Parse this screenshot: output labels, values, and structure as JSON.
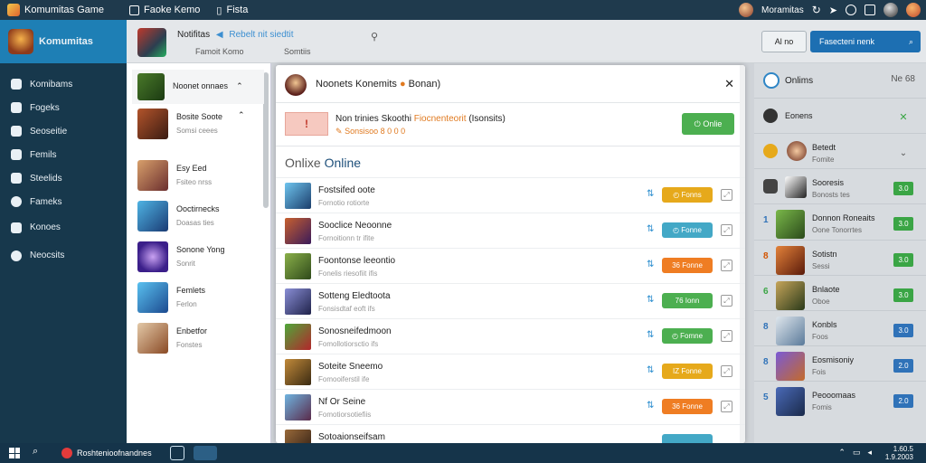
{
  "titlebar": {
    "app_title": "Komumitas Game",
    "menu1": "Faoke Kemo",
    "menu2": "Fista",
    "user_name": "Moramitas"
  },
  "sidebar": {
    "brand": "Komumitas",
    "items": [
      {
        "label": "Komibams",
        "icon": "book-icon"
      },
      {
        "label": "Fogeks",
        "icon": "card-icon"
      },
      {
        "label": "Seoseitie",
        "icon": "briefcase-icon"
      },
      {
        "label": "Femils",
        "icon": "chat-icon"
      },
      {
        "label": "Steelids",
        "icon": "list-icon"
      },
      {
        "label": "Fameks",
        "icon": "heart-icon"
      },
      {
        "label": "Konoes",
        "icon": "people-icon"
      },
      {
        "label": "Neocsits",
        "icon": "toggle-icon"
      }
    ]
  },
  "header": {
    "title": "Notifitas",
    "link": "Rebelt nit siedtit",
    "sub1": "Famoit Komo",
    "sub2": "Somtiis",
    "btn_secondary": "Al no",
    "btn_primary": "Fasecteni nenk"
  },
  "games": [
    {
      "name": "Noonet onnaes",
      "desc": ""
    },
    {
      "name": "Bosite Soote",
      "desc": "Somsi ceees"
    },
    {
      "name": "Esy Eed",
      "desc": "Fsiteo nrss"
    },
    {
      "name": "Ooctirnecks",
      "desc": "Doasas ties"
    },
    {
      "name": "Sonone Yong",
      "desc": "Sonrit"
    },
    {
      "name": "Femlets",
      "desc": "Ferlon"
    },
    {
      "name": "Enbetfor",
      "desc": "Fonstes"
    }
  ],
  "modal": {
    "title": "Noonets Konemits",
    "title_extra": "Bonan)",
    "banner_text": "Non trinies Skoothi",
    "banner_highlight": "Fiocnenteorit",
    "banner_paren": "(Isonsits)",
    "banner_sub": "Sonsisoo 8 0 0 0",
    "banner_button": "Onlie",
    "section_label": "Onlixe",
    "section_bold": "Online",
    "rows": [
      {
        "name": "Fostsifed oote",
        "sub": "Fornotio rotiorte",
        "badge": "Fonns",
        "badge_color": "#e6a91b",
        "badge_icon": "clock-icon"
      },
      {
        "name": "Sooclice Neoonne",
        "sub": "Fornoitionn tr ifite",
        "badge": "Fonne",
        "badge_color": "#43a8c6",
        "badge_icon": "clock-icon"
      },
      {
        "name": "Foontonse leeontio",
        "sub": "Fonelis riesofiit ifis",
        "badge": "36 Fonne",
        "badge_color": "#ef7d23",
        "badge_icon": ""
      },
      {
        "name": "Sotteng Eledtoota",
        "sub": "Fonsisdtaf eoft ifs",
        "badge": "76 Ionn",
        "badge_color": "#4caf50",
        "badge_icon": ""
      },
      {
        "name": "Sonosneifedmoon",
        "sub": "Fomollotiorsctio ifs",
        "badge": "Fomne",
        "badge_color": "#4caf50",
        "badge_icon": "clock-icon"
      },
      {
        "name": "Soteite Sneemo",
        "sub": "Fomooiferstil ife",
        "badge": "IZ Fonne",
        "badge_color": "#e6a91b",
        "badge_icon": ""
      },
      {
        "name": "Nf Or Seine",
        "sub": "Fomotiorsotiefiis",
        "badge": "36 Fonne",
        "badge_color": "#ef7d23",
        "badge_icon": ""
      },
      {
        "name": "Sotoaionseifsam",
        "sub": "",
        "badge": "",
        "badge_color": "#43a8c6",
        "badge_icon": ""
      }
    ]
  },
  "right_panel": {
    "header": "Onlims",
    "header_right": "Ne 68",
    "rows": [
      {
        "name": "Eonens",
        "sub": "",
        "badge": "✕",
        "badge_color": "#3aa545"
      },
      {
        "name": "Betedt",
        "sub": "Fomite",
        "badge": "✓",
        "badge_color": "#555555"
      },
      {
        "name": "Sooresis",
        "sub": "Bonosts tes",
        "badge": "3.0",
        "badge_color": "#3aa545"
      },
      {
        "name": "Donnon Roneaits",
        "sub": "Oone\nTonorrtes",
        "badge": "3.0",
        "badge_color": "#3aa545",
        "num": "1"
      },
      {
        "name": "Sotistn",
        "sub": "Sessi",
        "badge": "3.0",
        "badge_color": "#3aa545",
        "num": "8"
      },
      {
        "name": "Bnlaote",
        "sub": "Oboe",
        "badge": "3.0",
        "badge_color": "#3aa545",
        "num": "6"
      },
      {
        "name": "Konbls",
        "sub": "Foos",
        "badge": "3.0",
        "badge_color": "#2f72b8",
        "num": "8"
      },
      {
        "name": "Eosmisoniy",
        "sub": "Fois",
        "badge": "2.0",
        "badge_color": "#2f72b8",
        "num": "8"
      },
      {
        "name": "Peooomaas",
        "sub": "Fomis",
        "badge": "2.0",
        "badge_color": "#2f72b8",
        "num": "5"
      }
    ]
  },
  "taskbar": {
    "app_label": "Roshtenioofnandnes",
    "clock_time": "1.60.5",
    "clock_date": "1.9.2003"
  }
}
